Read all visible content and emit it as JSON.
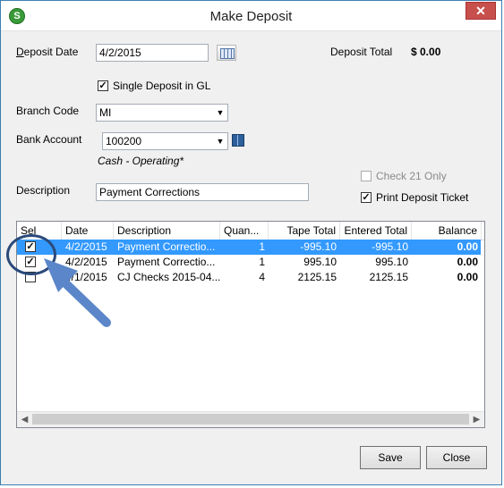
{
  "window": {
    "title": "Make Deposit",
    "app_icon": "S",
    "close_glyph": "✕"
  },
  "form": {
    "deposit_date_label": "Deposit Date",
    "deposit_date_value": "4/2/2015",
    "deposit_total_label": "Deposit Total",
    "deposit_total_value": "$ 0.00",
    "single_deposit_label": "Single Deposit in GL",
    "single_deposit_checked": true,
    "branch_code_label": "Branch Code",
    "branch_code_value": "MI",
    "bank_account_label": "Bank Account",
    "bank_account_value": "100200",
    "bank_account_desc": "Cash - Operating*",
    "check21_label": "Check 21 Only",
    "print_ticket_label": "Print Deposit Ticket",
    "description_label": "Description",
    "description_value": "Payment Corrections"
  },
  "grid": {
    "columns": [
      "Sel",
      "Date",
      "Description",
      "Quan...",
      "Tape Total",
      "Entered Total",
      "Balance"
    ],
    "rows": [
      {
        "sel": true,
        "date": "4/2/2015",
        "description": "Payment Correctio...",
        "qty": "1",
        "tape": "-995.10",
        "entered": "-995.10",
        "balance": "0.00",
        "selected": true
      },
      {
        "sel": true,
        "date": "4/2/2015",
        "description": "Payment Correctio...",
        "qty": "1",
        "tape": "995.10",
        "entered": "995.10",
        "balance": "0.00",
        "selected": false
      },
      {
        "sel": false,
        "date": "4/1/2015",
        "description": "CJ Checks 2015-04...",
        "qty": "4",
        "tape": "2125.15",
        "entered": "2125.15",
        "balance": "0.00",
        "selected": false
      }
    ]
  },
  "buttons": {
    "save": "Save",
    "close": "Close"
  },
  "colors": {
    "selection": "#3399ff",
    "callout": "#5b86c9"
  }
}
